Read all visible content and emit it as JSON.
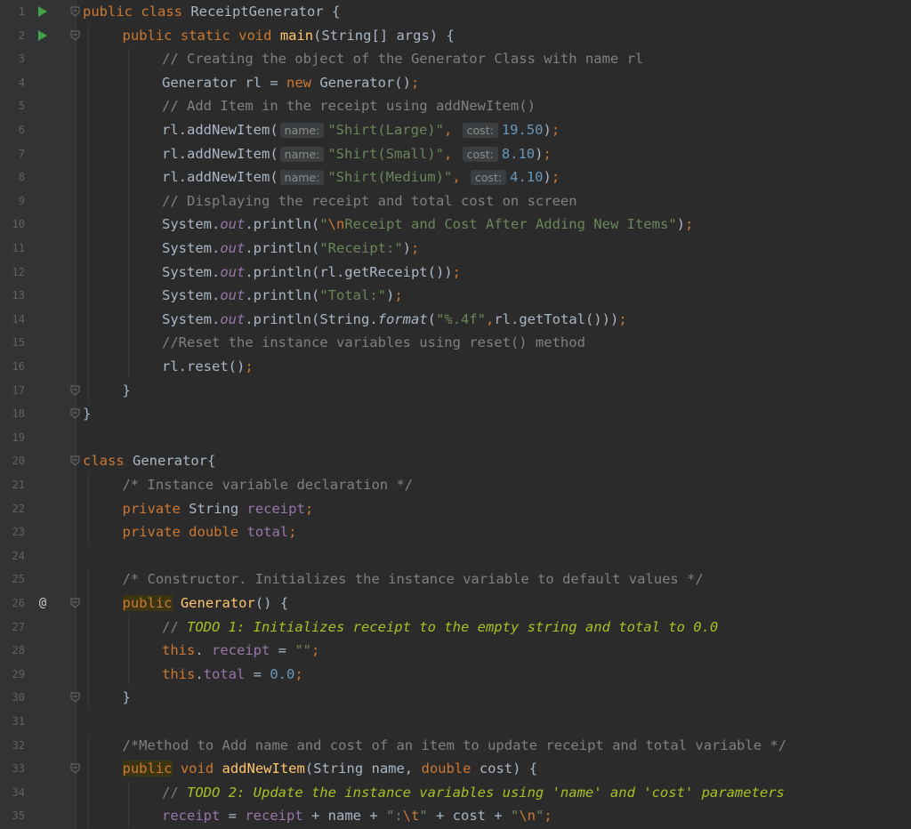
{
  "editor": {
    "language": "java",
    "line_numbers": [
      "1",
      "2",
      "3",
      "4",
      "5",
      "6",
      "7",
      "8",
      "9",
      "10",
      "11",
      "12",
      "13",
      "14",
      "15",
      "16",
      "17",
      "18",
      "19",
      "20",
      "21",
      "22",
      "23",
      "24",
      "25",
      "26",
      "27",
      "28",
      "29",
      "30",
      "31",
      "32",
      "33",
      "34",
      "35"
    ],
    "gutter_icons": {
      "run": [
        1,
        2
      ],
      "override": [
        26
      ],
      "fold": [
        1,
        2,
        17,
        18,
        20,
        26,
        30,
        33
      ]
    },
    "colors": {
      "background": "#2b2b2b",
      "keyword": "#cc7832",
      "method_decl": "#ffc66d",
      "string": "#6a8759",
      "number": "#6897bb",
      "comment": "#808080",
      "todo": "#a8c023",
      "field": "#9876aa",
      "run_icon": "#43a047"
    },
    "lines": [
      {
        "indent": 0,
        "tokens": [
          [
            "kw",
            "public class "
          ],
          [
            "",
            "ReceiptGenerator {"
          ]
        ]
      },
      {
        "indent": 1,
        "tokens": [
          [
            "kw",
            "public static void "
          ],
          [
            "fn",
            "main"
          ],
          [
            "",
            "(String[] args) {"
          ]
        ]
      },
      {
        "indent": 2,
        "tokens": [
          [
            "cm",
            "// Creating the object of the Generator Class with name rl"
          ]
        ]
      },
      {
        "indent": 2,
        "tokens": [
          [
            "",
            "Generator rl = "
          ],
          [
            "kw",
            "new "
          ],
          [
            "",
            "Generator()"
          ],
          [
            "kw",
            ";"
          ]
        ]
      },
      {
        "indent": 2,
        "tokens": [
          [
            "cm",
            "// Add Item in the receipt using addNewItem()"
          ]
        ]
      },
      {
        "indent": 2,
        "tokens": [
          [
            "",
            "rl.addNewItem("
          ],
          [
            "hint",
            "name:"
          ],
          [
            "str",
            "\"Shirt(Large)\""
          ],
          [
            "kw",
            ", "
          ],
          [
            "hint",
            "cost:"
          ],
          [
            "num",
            "19.50"
          ],
          [
            "",
            ")"
          ],
          [
            "kw",
            ";"
          ]
        ]
      },
      {
        "indent": 2,
        "tokens": [
          [
            "",
            "rl.addNewItem("
          ],
          [
            "hint",
            "name:"
          ],
          [
            "str",
            "\"Shirt(Small)\""
          ],
          [
            "kw",
            ", "
          ],
          [
            "hint",
            "cost:"
          ],
          [
            "num",
            "8.10"
          ],
          [
            "",
            ")"
          ],
          [
            "kw",
            ";"
          ]
        ]
      },
      {
        "indent": 2,
        "tokens": [
          [
            "",
            "rl.addNewItem("
          ],
          [
            "hint",
            "name:"
          ],
          [
            "str",
            "\"Shirt(Medium)\""
          ],
          [
            "kw",
            ", "
          ],
          [
            "hint",
            "cost:"
          ],
          [
            "num",
            "4.10"
          ],
          [
            "",
            ")"
          ],
          [
            "kw",
            ";"
          ]
        ]
      },
      {
        "indent": 2,
        "tokens": [
          [
            "cm",
            "// Displaying the receipt and total cost on screen"
          ]
        ]
      },
      {
        "indent": 2,
        "tokens": [
          [
            "",
            "System."
          ],
          [
            "sfld",
            "out"
          ],
          [
            "",
            ".println("
          ],
          [
            "str",
            "\""
          ],
          [
            "esc",
            "\\n"
          ],
          [
            "str",
            "Receipt and Cost After Adding New Items\""
          ],
          [
            "",
            ")"
          ],
          [
            "kw",
            ";"
          ]
        ]
      },
      {
        "indent": 2,
        "tokens": [
          [
            "",
            "System."
          ],
          [
            "sfld",
            "out"
          ],
          [
            "",
            ".println("
          ],
          [
            "str",
            "\"Receipt:\""
          ],
          [
            "",
            ")"
          ],
          [
            "kw",
            ";"
          ]
        ]
      },
      {
        "indent": 2,
        "tokens": [
          [
            "",
            "System."
          ],
          [
            "sfld",
            "out"
          ],
          [
            "",
            ".println(rl.getReceipt())"
          ],
          [
            "kw",
            ";"
          ]
        ]
      },
      {
        "indent": 2,
        "tokens": [
          [
            "",
            "System."
          ],
          [
            "sfld",
            "out"
          ],
          [
            "",
            ".println("
          ],
          [
            "str",
            "\"Total:\""
          ],
          [
            "",
            ")"
          ],
          [
            "kw",
            ";"
          ]
        ]
      },
      {
        "indent": 2,
        "tokens": [
          [
            "",
            "System."
          ],
          [
            "sfld",
            "out"
          ],
          [
            "",
            ".println(String."
          ],
          [
            "smeth",
            "format"
          ],
          [
            "",
            "("
          ],
          [
            "str",
            "\"%.4f\""
          ],
          [
            "kw",
            ","
          ],
          [
            "",
            "rl.getTotal()))"
          ],
          [
            "kw",
            ";"
          ]
        ]
      },
      {
        "indent": 2,
        "tokens": [
          [
            "cm",
            "//Reset the instance variables using reset() method"
          ]
        ]
      },
      {
        "indent": 2,
        "tokens": [
          [
            "",
            "rl.reset()"
          ],
          [
            "kw",
            ";"
          ]
        ]
      },
      {
        "indent": 1,
        "tokens": [
          [
            "",
            "}"
          ]
        ]
      },
      {
        "indent": 0,
        "tokens": [
          [
            "",
            "}"
          ]
        ]
      },
      {
        "indent": 0,
        "tokens": []
      },
      {
        "indent": 0,
        "tokens": [
          [
            "kw",
            "class "
          ],
          [
            "",
            "Generator{"
          ]
        ]
      },
      {
        "indent": 1,
        "tokens": [
          [
            "cm",
            "/* Instance variable declaration */"
          ]
        ]
      },
      {
        "indent": 1,
        "tokens": [
          [
            "kw",
            "private "
          ],
          [
            "",
            "String "
          ],
          [
            "fld",
            "receipt"
          ],
          [
            "kw",
            ";"
          ]
        ]
      },
      {
        "indent": 1,
        "tokens": [
          [
            "kw",
            "private double "
          ],
          [
            "fld",
            "total"
          ],
          [
            "kw",
            ";"
          ]
        ]
      },
      {
        "indent": 0,
        "tokens": []
      },
      {
        "indent": 1,
        "tokens": [
          [
            "cm",
            "/* Constructor. Initializes the instance variable to default values */"
          ]
        ]
      },
      {
        "indent": 1,
        "tokens": [
          [
            "kwhl",
            "public"
          ],
          [
            "fn",
            " Generator"
          ],
          [
            "",
            "() {"
          ]
        ]
      },
      {
        "indent": 2,
        "tokens": [
          [
            "cm",
            "// "
          ],
          [
            "todo",
            "TODO 1: Initializes receipt to the empty string and total to 0.0"
          ]
        ]
      },
      {
        "indent": 2,
        "tokens": [
          [
            "kw",
            "this"
          ],
          [
            "",
            ". "
          ],
          [
            "fld",
            "receipt"
          ],
          [
            "",
            " = "
          ],
          [
            "str",
            "\"\""
          ],
          [
            "kw",
            ";"
          ]
        ]
      },
      {
        "indent": 2,
        "tokens": [
          [
            "kw",
            "this"
          ],
          [
            "",
            "."
          ],
          [
            "fld",
            "total"
          ],
          [
            "",
            " = "
          ],
          [
            "num",
            "0.0"
          ],
          [
            "kw",
            ";"
          ]
        ]
      },
      {
        "indent": 1,
        "tokens": [
          [
            "",
            "}"
          ]
        ]
      },
      {
        "indent": 0,
        "tokens": []
      },
      {
        "indent": 1,
        "tokens": [
          [
            "cm",
            "/*Method to Add name and cost of an item to update receipt and total variable */"
          ]
        ]
      },
      {
        "indent": 1,
        "tokens": [
          [
            "kwhl",
            "public"
          ],
          [
            "kw",
            " void "
          ],
          [
            "fn",
            "addNewItem"
          ],
          [
            "",
            "(String name, "
          ],
          [
            "kw",
            "double "
          ],
          [
            "",
            "cost) {"
          ]
        ]
      },
      {
        "indent": 2,
        "tokens": [
          [
            "cm",
            "// "
          ],
          [
            "todo",
            "TODO 2: Update the instance variables using 'name' and 'cost' parameters"
          ]
        ]
      },
      {
        "indent": 2,
        "tokens": [
          [
            "fld",
            "receipt"
          ],
          [
            "",
            " = "
          ],
          [
            "fld",
            "receipt"
          ],
          [
            "",
            " + name + "
          ],
          [
            "str",
            "\":"
          ],
          [
            "esc",
            "\\t"
          ],
          [
            "str",
            "\""
          ],
          [
            "",
            " + cost + "
          ],
          [
            "str",
            "\""
          ],
          [
            "esc",
            "\\n"
          ],
          [
            "str",
            "\""
          ],
          [
            "kw",
            ";"
          ]
        ]
      }
    ]
  }
}
